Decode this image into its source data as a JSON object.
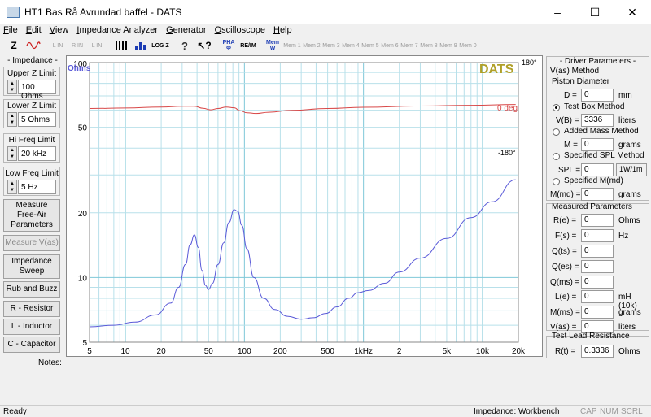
{
  "window": {
    "title": "HT1 Bas Rå Avrundad baffel - DATS",
    "minimize": "–",
    "maximize": "☐",
    "close": "✕"
  },
  "menu": [
    {
      "label": "File",
      "key": "F",
      "rest": "ile"
    },
    {
      "label": "Edit",
      "key": "E",
      "rest": "dit"
    },
    {
      "label": "View",
      "key": "V",
      "rest": "iew"
    },
    {
      "label": "Impedance Analyzer",
      "key": "I",
      "rest": "mpedance Analyzer"
    },
    {
      "label": "Generator",
      "key": "G",
      "rest": "enerator"
    },
    {
      "label": "Oscilloscope",
      "key": "O",
      "rest": "scilloscope"
    },
    {
      "label": "Help",
      "key": "H",
      "rest": "elp"
    }
  ],
  "toolbar": {
    "z": "Z",
    "l_in": "L IN",
    "r_in": "R IN",
    "l_in2": "L IN",
    "log": "LOG Z",
    "pha": "PHA Φ",
    "re_im": "RE/IM",
    "mem_w": "Mem W",
    "mem_slots": [
      "Mem 1",
      "Mem 2",
      "Mem 3",
      "Mem 4",
      "Mem 5",
      "Mem 6",
      "Mem 7",
      "Mem 8",
      "Mem 9",
      "Mem 0"
    ]
  },
  "left": {
    "impedance_title": "- Impedance -",
    "upper_z": {
      "label": "Upper Z Limit",
      "value": "100 Ohms"
    },
    "lower_z": {
      "label": "Lower Z Limit",
      "value": "5 Ohms"
    },
    "hi_freq": {
      "label": "Hi Freq Limit",
      "value": "20 kHz"
    },
    "low_freq": {
      "label": "Low Freq Limit",
      "value": "5 Hz"
    },
    "buttons": {
      "measure_free_air": [
        "Measure",
        "Free-Air",
        "Parameters"
      ],
      "measure_vas": "Measure V(as)",
      "impedance_sweep": [
        "Impedance",
        "Sweep"
      ],
      "rub_buzz": "Rub and Buzz",
      "r_resistor": "R - Resistor",
      "l_inductor": "L - Inductor",
      "c_capacitor": "C - Capacitor"
    }
  },
  "chart_data": {
    "type": "line",
    "brand": "DATS",
    "y_unit_label": "Ohms",
    "x_scale": "log",
    "y_scale": "log",
    "xlim": [
      5,
      20000
    ],
    "ylim": [
      5,
      100
    ],
    "x_ticks": [
      {
        "v": 5,
        "t": "5"
      },
      {
        "v": 10,
        "t": "10"
      },
      {
        "v": 20,
        "t": "20"
      },
      {
        "v": 50,
        "t": "50"
      },
      {
        "v": 100,
        "t": "100"
      },
      {
        "v": 200,
        "t": "200"
      },
      {
        "v": 500,
        "t": "500"
      },
      {
        "v": 1000,
        "t": "1kHz"
      },
      {
        "v": 2000,
        "t": "2"
      },
      {
        "v": 5000,
        "t": "5k"
      },
      {
        "v": 10000,
        "t": "10k"
      },
      {
        "v": 20000,
        "t": "20k"
      }
    ],
    "y_ticks": [
      {
        "v": 100,
        "t": "100"
      },
      {
        "v": 50,
        "t": "50"
      },
      {
        "v": 20,
        "t": "20"
      },
      {
        "v": 10,
        "t": "10"
      },
      {
        "v": 5,
        "t": "5"
      }
    ],
    "phase_axis": {
      "ticks": [
        "180°",
        "0 deg",
        "-180°"
      ],
      "range": [
        -180,
        180
      ]
    },
    "series": [
      {
        "color": "#5a5ad8",
        "points": [
          [
            5,
            5.9
          ],
          [
            8,
            6.0
          ],
          [
            12,
            6.2
          ],
          [
            18,
            6.7
          ],
          [
            24,
            7.6
          ],
          [
            28,
            9.0
          ],
          [
            32,
            11.5
          ],
          [
            35,
            14.2
          ],
          [
            38,
            15.8
          ],
          [
            41,
            13.8
          ],
          [
            44,
            10.8
          ],
          [
            47,
            9.2
          ],
          [
            50,
            8.8
          ],
          [
            54,
            9.4
          ],
          [
            60,
            11.5
          ],
          [
            67,
            14.5
          ],
          [
            74,
            18.0
          ],
          [
            82,
            20.7
          ],
          [
            88,
            20.3
          ],
          [
            95,
            17.5
          ],
          [
            105,
            13.6
          ],
          [
            120,
            10.0
          ],
          [
            145,
            8.0
          ],
          [
            180,
            7.1
          ],
          [
            230,
            6.6
          ],
          [
            300,
            6.4
          ],
          [
            380,
            6.5
          ],
          [
            480,
            6.8
          ],
          [
            600,
            7.3
          ],
          [
            750,
            8.0
          ],
          [
            900,
            8.5
          ],
          [
            1100,
            8.7
          ],
          [
            1500,
            9.4
          ],
          [
            2000,
            10.6
          ],
          [
            3000,
            12.3
          ],
          [
            5000,
            15.2
          ],
          [
            8000,
            19.0
          ],
          [
            12000,
            22.5
          ],
          [
            19000,
            28.5
          ]
        ]
      },
      {
        "color": "#d84848",
        "axis": "phase",
        "points": [
          [
            5,
            -5
          ],
          [
            10,
            -3
          ],
          [
            20,
            1
          ],
          [
            30,
            4
          ],
          [
            38,
            4
          ],
          [
            45,
            -4
          ],
          [
            52,
            -10
          ],
          [
            60,
            -5
          ],
          [
            70,
            1
          ],
          [
            82,
            -2
          ],
          [
            92,
            -14
          ],
          [
            105,
            -22
          ],
          [
            125,
            -25
          ],
          [
            160,
            -20
          ],
          [
            250,
            -12
          ],
          [
            500,
            -5
          ],
          [
            1000,
            0
          ],
          [
            3000,
            5
          ],
          [
            8000,
            8
          ],
          [
            19000,
            11
          ]
        ]
      }
    ]
  },
  "right": {
    "title": "- Driver Parameters -",
    "vas_method": "V(as) Method",
    "piston_diameter": "Piston Diameter",
    "d": {
      "label": "D =",
      "value": "0",
      "unit": "mm"
    },
    "test_box": "Test Box Method",
    "vb": {
      "label": "V(B) =",
      "value": "3336",
      "unit": "liters"
    },
    "added_mass": "Added Mass Method",
    "m": {
      "label": "M =",
      "value": "0",
      "unit": "grams"
    },
    "spl_method": "Specified SPL Method",
    "spl": {
      "label": "SPL =",
      "value": "0",
      "unit": "1W/1m"
    },
    "specified_mmd": "Specified M(md)",
    "mmd": {
      "label": "M(md) =",
      "value": "0",
      "unit": "grams"
    },
    "measured_title": "Measured Parameters",
    "measured": [
      {
        "label": "R(e) =",
        "value": "0",
        "unit": "Ohms"
      },
      {
        "label": "F(s) =",
        "value": "0",
        "unit": "Hz"
      },
      {
        "label": "Q(ts) =",
        "value": "0",
        "unit": ""
      },
      {
        "label": "Q(es) =",
        "value": "0",
        "unit": ""
      },
      {
        "label": "Q(ms) =",
        "value": "0",
        "unit": ""
      },
      {
        "label": "L(e) =",
        "value": "0",
        "unit": "mH (10k)"
      },
      {
        "label": "M(ms) =",
        "value": "0",
        "unit": "grams"
      },
      {
        "label": "V(as) =",
        "value": "0",
        "unit": "liters"
      }
    ],
    "lead_title": "Test Lead Resistance",
    "rt": {
      "label": "R(t) =",
      "value": "0.3336",
      "unit": "Ohms"
    }
  },
  "notes_label": "Notes:",
  "status": {
    "left": "Ready",
    "mode": "Impedance: Workbench",
    "cap": "CAP",
    "num": "NUM",
    "scrl": "SCRL"
  }
}
